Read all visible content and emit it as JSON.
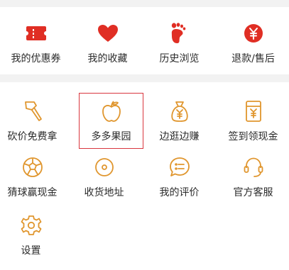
{
  "colors": {
    "accent_red": "#e02e24",
    "outline_orange": "#e0962e",
    "highlight_border": "#d9363e",
    "text": "#2b2b2b"
  },
  "top_row": [
    {
      "label": "我的优惠券",
      "icon": "coupon-icon"
    },
    {
      "label": "我的收藏",
      "icon": "heart-icon"
    },
    {
      "label": "历史浏览",
      "icon": "footprint-icon"
    },
    {
      "label": "退款/售后",
      "icon": "yuan-refund-icon"
    }
  ],
  "grid": [
    {
      "label": "砍价免费拿",
      "icon": "axe-icon"
    },
    {
      "label": "多多果园",
      "icon": "apple-icon",
      "highlighted": true
    },
    {
      "label": "边逛边赚",
      "icon": "money-bag-icon"
    },
    {
      "label": "签到领现金",
      "icon": "red-envelope-icon"
    },
    {
      "label": "猜球赢现金",
      "icon": "soccer-ball-icon"
    },
    {
      "label": "收货地址",
      "icon": "location-icon"
    },
    {
      "label": "我的评价",
      "icon": "comment-icon"
    },
    {
      "label": "官方客服",
      "icon": "headset-icon"
    },
    {
      "label": "设置",
      "icon": "gear-icon"
    }
  ]
}
